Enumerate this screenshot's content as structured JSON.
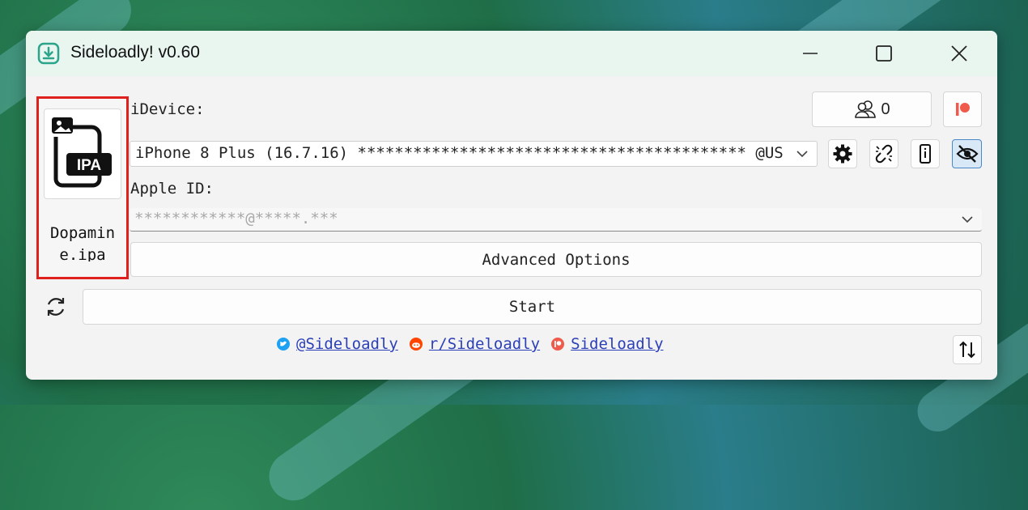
{
  "window": {
    "title": "Sideloadly! v0.60",
    "controls": [
      "minimize",
      "maximize",
      "close"
    ]
  },
  "ipa": {
    "icon_label": "IPA",
    "file_name": "Dopamine.ipa"
  },
  "device": {
    "label": "iDevice:",
    "selected": "iPhone 8 Plus (16.7.16) ****************************************** @US",
    "peers_count": "0"
  },
  "apple_id": {
    "label": "Apple ID:",
    "placeholder": "************@*****.***"
  },
  "buttons": {
    "advanced": "Advanced Options",
    "start": "Start"
  },
  "footer": {
    "twitter": "@Sideloadly",
    "reddit": "r/Sideloadly",
    "patreon": "Sideloadly"
  },
  "icons": {
    "app": "download-box-icon",
    "peers": "people-icon",
    "patreon": "patreon-icon",
    "settings": "gear-icon",
    "unlink": "broken-link-icon",
    "device": "phone-info-icon",
    "visibility": "eye-off-icon",
    "refresh": "refresh-icon",
    "sort": "sort-arrows-icon"
  },
  "colors": {
    "highlight_border": "#e0201c",
    "accent": "#2aa58b",
    "link": "#2b3fb8",
    "patreon": "#f05a4c",
    "twitter": "#1da1f2",
    "reddit": "#ff4500"
  }
}
